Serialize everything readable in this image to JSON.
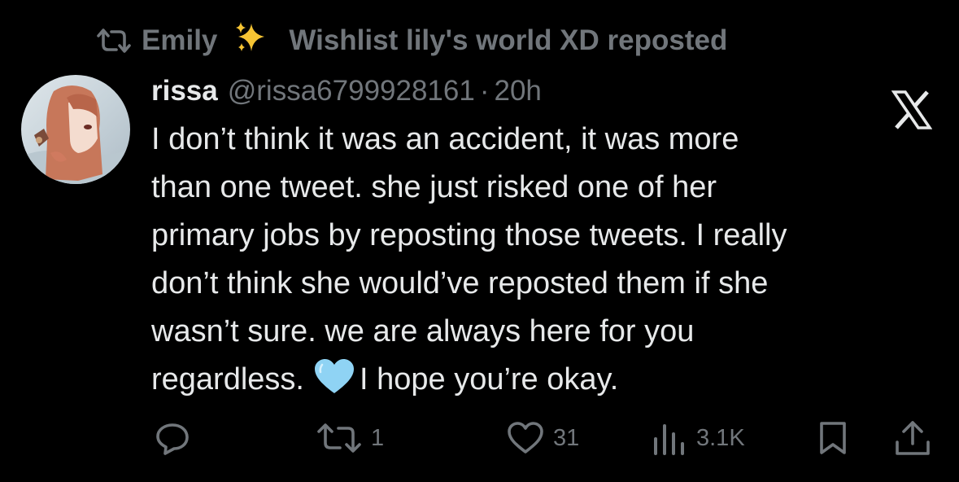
{
  "repost_banner": {
    "icon": "repost-icon",
    "name_part_1": "Emily",
    "emoji": "sparkles",
    "name_part_2": "Wishlist lily's world XD reposted"
  },
  "tweet": {
    "author_name": "rissa",
    "handle": "@rissa6799928161",
    "separator": "·",
    "time": "20h",
    "text_lines": [
      "I don’t think it was an accident, it was more",
      "than one tweet. she just risked one of her",
      "primary jobs by reposting those tweets. I really",
      "don’t think she would’ve reposted them if she",
      "wasn’t sure. we are always here for you",
      "regardless."
    ],
    "emoji": "light-blue-heart",
    "text_tail": "I hope you’re okay."
  },
  "actions": {
    "reply": {
      "icon": "reply-icon",
      "count": ""
    },
    "repost": {
      "icon": "repost-icon",
      "count": "1"
    },
    "like": {
      "icon": "heart-outline-icon",
      "count": "31"
    },
    "views": {
      "icon": "views-icon",
      "count": "3.1K"
    },
    "bookmark": {
      "icon": "bookmark-icon"
    },
    "share": {
      "icon": "share-icon"
    }
  },
  "colors": {
    "background": "#000000",
    "primary_text": "#e7e9ea",
    "secondary_text": "#71767b",
    "heart_emoji": "#8fd3f4"
  }
}
